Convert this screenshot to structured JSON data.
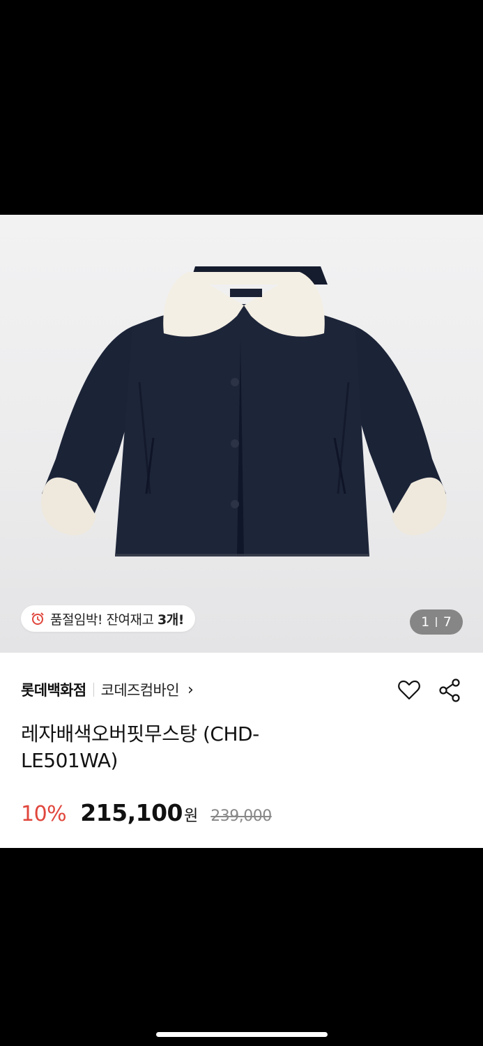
{
  "gallery": {
    "stock_text": "품절임박! 잔여재고 ",
    "stock_count": "3개!",
    "current_page": "1",
    "total_pages": "7"
  },
  "product": {
    "store": "롯데백화점",
    "brand": "코데즈컴바인",
    "brand_chevron": "›",
    "title": "레자배색오버핏무스탕 (CHD-LE501WA)",
    "discount": "10%",
    "price": "215,100",
    "currency": "원",
    "original_price": "239,000"
  },
  "icons": {
    "stock": "alarm-clock-icon",
    "wishlist": "heart-icon",
    "share": "share-icon"
  },
  "colors": {
    "discount": "#e0463c",
    "jacket_navy": "#1a2236",
    "collar_cream": "#f4efe4"
  }
}
